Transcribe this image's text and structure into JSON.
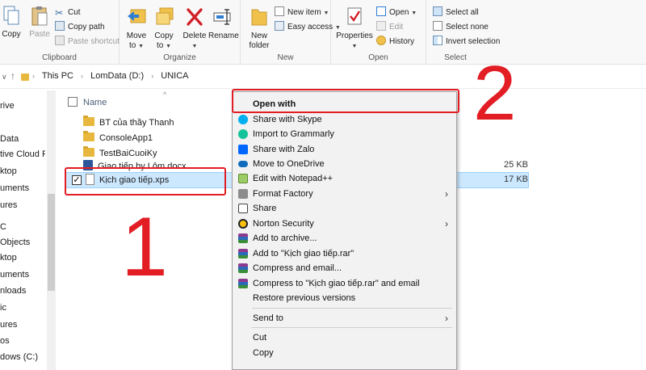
{
  "ribbon": {
    "clipboard": {
      "copy": "Copy",
      "paste": "Paste",
      "cut": "Cut",
      "copy_path": "Copy path",
      "paste_shortcut": "Paste shortcut",
      "group": "Clipboard"
    },
    "organize": {
      "move_to_1": "Move",
      "move_to_2": "to",
      "copy_to_1": "Copy",
      "copy_to_2": "to",
      "delete": "Delete",
      "rename": "Rename",
      "group": "Organize"
    },
    "new": {
      "new_folder_1": "New",
      "new_folder_2": "folder",
      "new_item": "New item",
      "easy_access": "Easy access",
      "group": "New"
    },
    "open": {
      "properties": "Properties",
      "open": "Open",
      "edit": "Edit",
      "history": "History",
      "group": "Open"
    },
    "select": {
      "select_all": "Select all",
      "select_none": "Select none",
      "invert": "Invert selection",
      "group": "Select"
    }
  },
  "address": {
    "crumbs": [
      "This PC",
      "LomData (D:)",
      "UNICA"
    ]
  },
  "navpane": {
    "items": [
      "rive",
      "Data",
      "tive Cloud Fi",
      "ktop",
      "uments",
      "ures",
      "C",
      "Objects",
      "ktop",
      "uments",
      "nloads",
      "ic",
      "ures",
      "os",
      "dows (C:)"
    ]
  },
  "filelist": {
    "name_header": "Name",
    "rows": [
      {
        "name": "BT của thầy Thanh",
        "size": ""
      },
      {
        "name": "ConsoleApp1",
        "size": ""
      },
      {
        "name": "TestBaiCuoiKy",
        "size": ""
      },
      {
        "name": "Giao tiếp by Lôm.docx",
        "size": "25 KB"
      },
      {
        "name": "Kịch giao tiếp.xps",
        "size": "17 KB"
      }
    ]
  },
  "annotations": {
    "num1": "1",
    "num2": "2"
  },
  "context_menu": {
    "items": [
      "Open with",
      "Share with Skype",
      "Import to Grammarly",
      "Share with Zalo",
      "Move to OneDrive",
      "Edit with Notepad++",
      "Format Factory",
      "Share",
      "Norton Security",
      "Add to archive...",
      "Add to \"Kịch giao tiếp.rar\"",
      "Compress and email...",
      "Compress to \"Kịch giao tiếp.rar\" and email",
      "Restore previous versions",
      "Send to",
      "Cut",
      "Copy"
    ]
  },
  "colors": {
    "annotation_red": "#e21d24",
    "selection": "#cce8ff",
    "ribbon_bg": "#f8f8f8",
    "menu_bg": "#f2f2f2"
  }
}
